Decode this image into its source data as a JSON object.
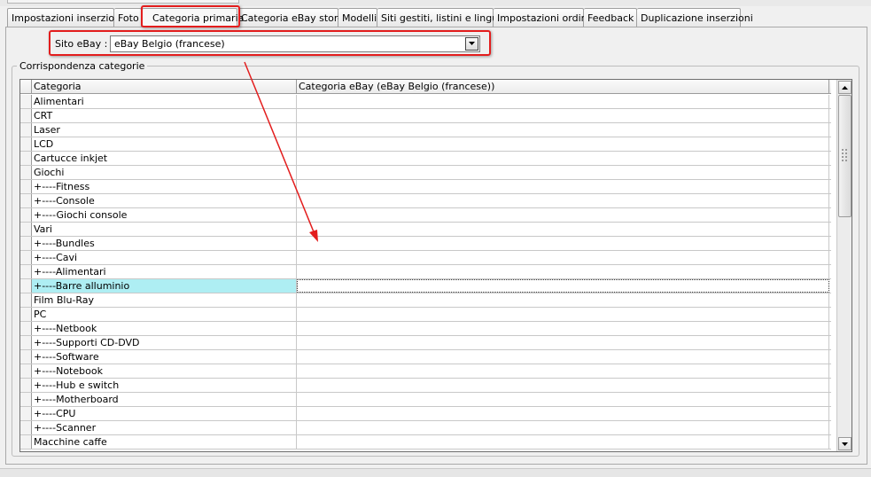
{
  "tabs": [
    {
      "label": "Impostazioni inserzioni",
      "active": false
    },
    {
      "label": "Foto",
      "active": false
    },
    {
      "label": "Categoria primaria",
      "active": true
    },
    {
      "label": "Categoria eBay store",
      "active": false
    },
    {
      "label": "Modelli",
      "active": false
    },
    {
      "label": "Siti gestiti, listini e lingue",
      "active": false
    },
    {
      "label": "Impostazioni ordini",
      "active": false
    },
    {
      "label": "Feedback",
      "active": false
    },
    {
      "label": "Duplicazione inserzioni",
      "active": false
    }
  ],
  "site": {
    "label": "Sito eBay :",
    "selected": "eBay Belgio (francese)"
  },
  "group": {
    "title": "Corrispondenza categorie"
  },
  "grid": {
    "columns": [
      "Categoria",
      "Categoria eBay (eBay Belgio (francese))"
    ],
    "selected_row": 13,
    "rows": [
      {
        "category": "Alimentari",
        "ebay_category": ""
      },
      {
        "category": "CRT",
        "ebay_category": ""
      },
      {
        "category": "Laser",
        "ebay_category": ""
      },
      {
        "category": "LCD",
        "ebay_category": ""
      },
      {
        "category": "Cartucce inkjet",
        "ebay_category": ""
      },
      {
        "category": "Giochi",
        "ebay_category": ""
      },
      {
        "category": "+----Fitness",
        "ebay_category": ""
      },
      {
        "category": "+----Console",
        "ebay_category": ""
      },
      {
        "category": "+----Giochi console",
        "ebay_category": ""
      },
      {
        "category": "Vari",
        "ebay_category": ""
      },
      {
        "category": "+----Bundles",
        "ebay_category": ""
      },
      {
        "category": "+----Cavi",
        "ebay_category": ""
      },
      {
        "category": "+----Alimentari",
        "ebay_category": ""
      },
      {
        "category": "+----Barre alluminio",
        "ebay_category": ""
      },
      {
        "category": "Film Blu-Ray",
        "ebay_category": ""
      },
      {
        "category": "PC",
        "ebay_category": ""
      },
      {
        "category": "+----Netbook",
        "ebay_category": ""
      },
      {
        "category": "+----Supporti CD-DVD",
        "ebay_category": ""
      },
      {
        "category": "+----Software",
        "ebay_category": ""
      },
      {
        "category": "+----Notebook",
        "ebay_category": ""
      },
      {
        "category": "+----Hub e switch",
        "ebay_category": ""
      },
      {
        "category": "+----Motherboard",
        "ebay_category": ""
      },
      {
        "category": "+----CPU",
        "ebay_category": ""
      },
      {
        "category": "+----Scanner",
        "ebay_category": ""
      },
      {
        "category": "Macchine caffe",
        "ebay_category": ""
      }
    ]
  },
  "icons": {
    "dropdown": "chevron-down-icon",
    "scroll_up": "scroll-up-arrow-icon",
    "scroll_down": "scroll-down-arrow-icon",
    "thumb_grip": "grip-icon",
    "annotation": "red-arrow-annotation"
  },
  "colors": {
    "highlight": "#e31d1d",
    "selected_row": "#aeeef3"
  }
}
